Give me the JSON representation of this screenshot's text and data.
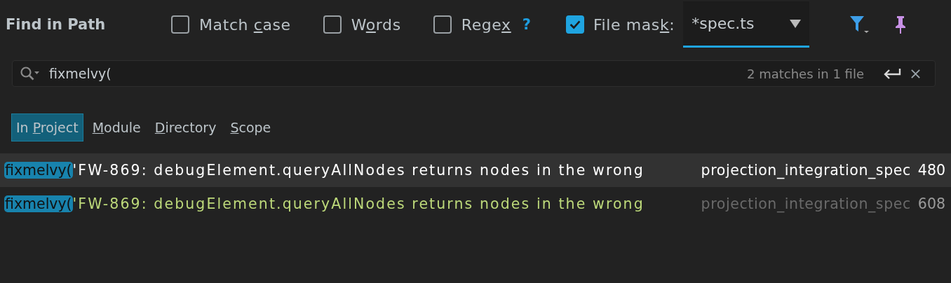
{
  "title": "Find in Path",
  "options": [
    {
      "start": "Match ",
      "mnemonic": "c",
      "end": "ase",
      "checked": false
    },
    {
      "start": "W",
      "mnemonic": "o",
      "end": "rds",
      "checked": false
    },
    {
      "start": "Rege",
      "mnemonic": "x",
      "checked": false,
      "help": "?"
    }
  ],
  "file_mask": {
    "start": "File mas",
    "mnemonic": "k",
    "end": ":",
    "checked": true,
    "value": "*spec.ts"
  },
  "search": {
    "value": "fixmelvy(",
    "status": "2 matches in 1 file"
  },
  "scopes": [
    {
      "start": "In ",
      "mnemonic": "P",
      "end": "roject",
      "selected": true
    },
    {
      "mnemonic": "M",
      "end": "odule",
      "selected": false
    },
    {
      "mnemonic": "D",
      "end": "irectory",
      "selected": false
    },
    {
      "mnemonic": "S",
      "end": "cope",
      "selected": false
    }
  ],
  "results": [
    {
      "match": "fixmelvy(",
      "text": "'FW-869: debugElement.queryAllNodes returns nodes in the wrong",
      "file": "projection_integration_spec",
      "line": "480",
      "selected": true
    },
    {
      "match": "fixmelvy(",
      "text": "'FW-869: debugElement.queryAllNodes returns nodes in the wrong",
      "file": "projection_integration_spec",
      "line": "608",
      "selected": false
    }
  ]
}
